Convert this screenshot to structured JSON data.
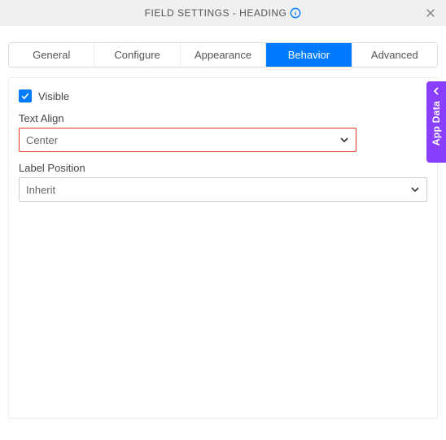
{
  "header": {
    "title": "FIELD SETTINGS - HEADING"
  },
  "tabs": {
    "items": [
      {
        "label": "General"
      },
      {
        "label": "Configure"
      },
      {
        "label": "Appearance"
      },
      {
        "label": "Behavior"
      },
      {
        "label": "Advanced"
      }
    ],
    "active_index": 3
  },
  "panel": {
    "visible": {
      "label": "Visible",
      "checked": true
    },
    "text_align": {
      "label": "Text Align",
      "value": "Center"
    },
    "label_position": {
      "label": "Label Position",
      "value": "Inherit"
    }
  },
  "side_panel": {
    "label": "App Data"
  },
  "colors": {
    "primary": "#007bff",
    "highlight": "#e7352c",
    "accent": "#8a3ffc"
  }
}
